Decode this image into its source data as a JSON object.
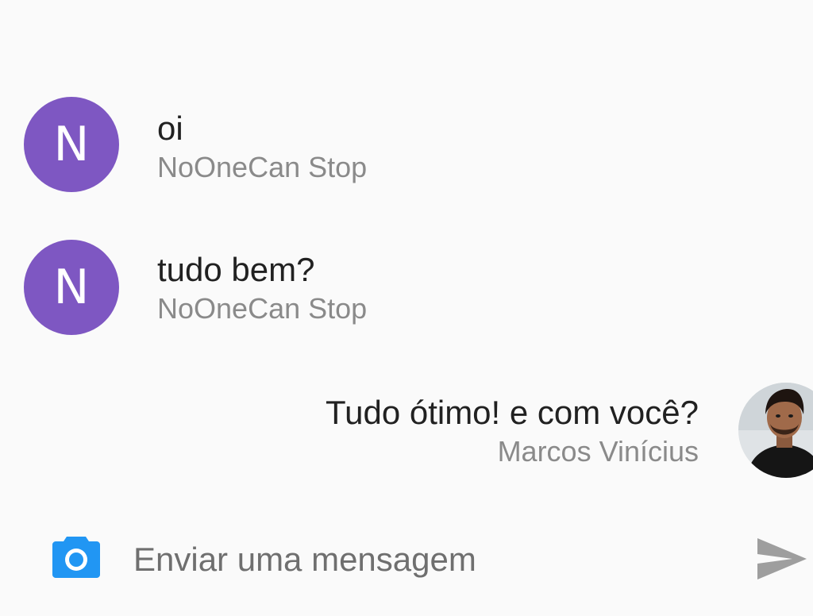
{
  "messages": [
    {
      "avatar_letter": "N",
      "text": "oi",
      "author": "NoOneCan Stop"
    },
    {
      "avatar_letter": "N",
      "text": "tudo bem?",
      "author": "NoOneCan Stop"
    },
    {
      "text": "Tudo ótimo! e com você?",
      "author": "Marcos Vinícius"
    }
  ],
  "composer": {
    "placeholder": "Enviar uma mensagem",
    "value": ""
  },
  "icons": {
    "camera": "camera-icon",
    "send": "send-icon"
  },
  "colors": {
    "avatar_bg": "#7e57c2",
    "camera_icon": "#2196f3",
    "send_icon": "#9e9e9e",
    "author_text": "#8a8a8a",
    "message_text": "#212121"
  }
}
